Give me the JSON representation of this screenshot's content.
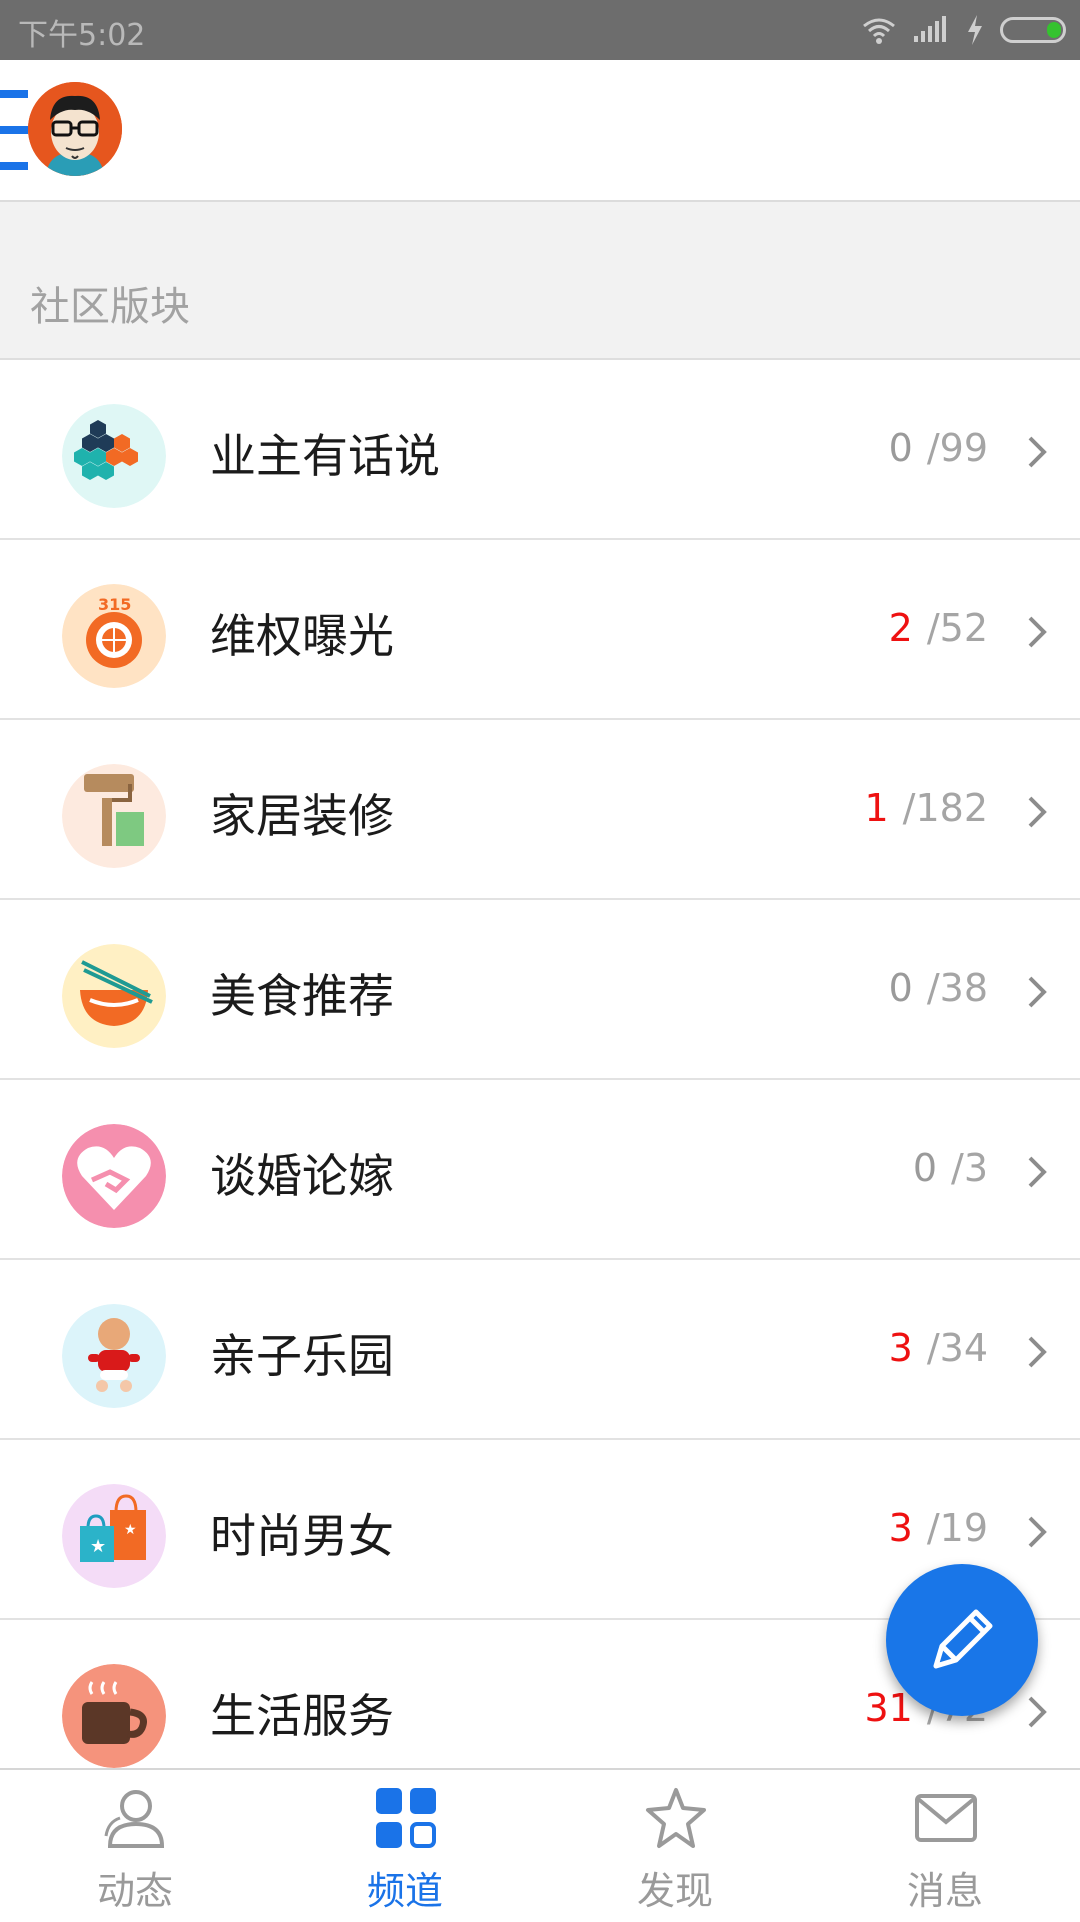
{
  "status_bar": {
    "time": "下午5:02"
  },
  "section": {
    "title": "社区版块"
  },
  "forums": [
    {
      "title": "业主有话说",
      "new_count": "0",
      "total": "/99",
      "new_highlight": false
    },
    {
      "title": "维权曝光",
      "new_count": "2",
      "total": "/52",
      "new_highlight": true
    },
    {
      "title": "家居装修",
      "new_count": "1",
      "total": "/182",
      "new_highlight": true
    },
    {
      "title": "美食推荐",
      "new_count": "0",
      "total": "/38",
      "new_highlight": false
    },
    {
      "title": "谈婚论嫁",
      "new_count": "0",
      "total": "/3",
      "new_highlight": false
    },
    {
      "title": "亲子乐园",
      "new_count": "3",
      "total": "/34",
      "new_highlight": true
    },
    {
      "title": "时尚男女",
      "new_count": "3",
      "total": "/19",
      "new_highlight": true
    },
    {
      "title": "生活服务",
      "new_count": "31",
      "total": "/72",
      "new_highlight": true
    }
  ],
  "bottom_nav": {
    "tabs": [
      {
        "label": "动态",
        "icon": "person-icon"
      },
      {
        "label": "频道",
        "icon": "grid-icon"
      },
      {
        "label": "发现",
        "icon": "star-icon"
      },
      {
        "label": "消息",
        "icon": "mail-icon"
      }
    ],
    "active": "频道"
  },
  "colors": {
    "accent": "#1a73e8",
    "highlight": "#ee1111",
    "fab": "#1976e8"
  }
}
